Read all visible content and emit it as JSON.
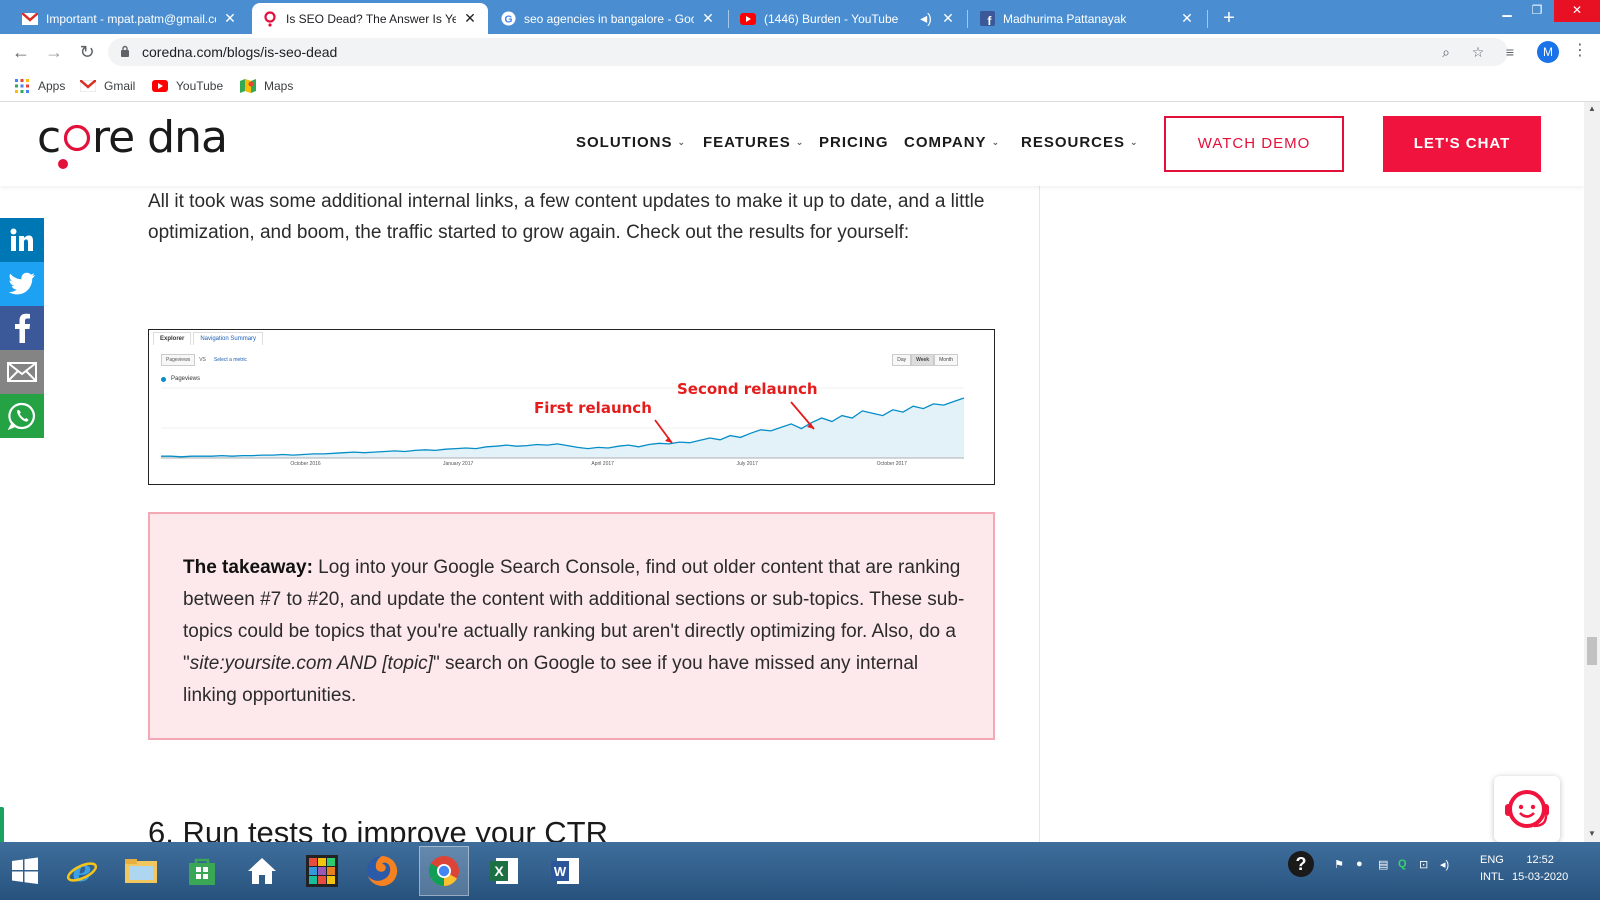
{
  "browser": {
    "tabs": [
      {
        "title": "Important - mpat.patm@gmail.co",
        "icon": "gmail-icon",
        "active": false
      },
      {
        "title": "Is SEO Dead? The Answer Is Yes,",
        "icon": "coredna-icon",
        "active": true
      },
      {
        "title": "seo agencies in bangalore - Goo",
        "icon": "google-icon",
        "active": false
      },
      {
        "title": "(1446) Burden - YouTube",
        "icon": "youtube-icon",
        "active": false
      },
      {
        "title": "Madhurima Pattanayak",
        "icon": "facebook-icon",
        "active": false
      }
    ],
    "close_glyph": "✕",
    "new_tab_glyph": "+",
    "url": "coredna.com/blogs/is-seo-dead",
    "avatar_letter": "M",
    "bookmarks": [
      {
        "label": "Apps",
        "icon": "apps-grid-icon"
      },
      {
        "label": "Gmail",
        "icon": "gmail-icon"
      },
      {
        "label": "YouTube",
        "icon": "youtube-icon"
      },
      {
        "label": "Maps",
        "icon": "maps-icon"
      }
    ]
  },
  "site": {
    "logo_text": "core dna",
    "nav": [
      {
        "label": "SOLUTIONS",
        "has_dropdown": true
      },
      {
        "label": "FEATURES",
        "has_dropdown": true
      },
      {
        "label": "PRICING",
        "has_dropdown": false
      },
      {
        "label": "COMPANY",
        "has_dropdown": true
      },
      {
        "label": "RESOURCES",
        "has_dropdown": true
      }
    ],
    "watch_demo": "WATCH DEMO",
    "lets_chat": "LET'S CHAT",
    "brand_color": "#f0133d"
  },
  "article": {
    "intro": "All it took was some additional internal links, a few content updates to make it up to date, and a little optimization, and boom, the traffic started to grow again. Check out the results for yourself:",
    "takeaway_label": "The takeaway:",
    "takeaway_text_1": " Log into your Google Search Console, find out older content that are ranking between #7 to #20, and update the content with additional sections or sub-topics. These sub-topics could be topics that you're actually ranking but aren't directly optimizing for. Also, do a \"",
    "takeaway_italic": "site:yoursite.com AND [topic]",
    "takeaway_text_2": "\" search on Google to see if you have missed any internal linking opportunities.",
    "next_heading": "6. Run tests to improve your CTR"
  },
  "share": [
    {
      "icon": "linkedin-icon",
      "label": "in",
      "color": "#0077b5"
    },
    {
      "icon": "twitter-icon",
      "label": "t",
      "color": "#1da1f2"
    },
    {
      "icon": "facebook-icon",
      "label": "f",
      "color": "#3b5998"
    },
    {
      "icon": "email-icon",
      "label": "✉",
      "color": "#848484"
    },
    {
      "icon": "whatsapp-icon",
      "label": "✆",
      "color": "#25a244"
    }
  ],
  "analytics": {
    "tabs": [
      "Explorer",
      "Navigation Summary"
    ],
    "metric": "Pageviews",
    "vs": "VS",
    "select_metric": "Select a metric",
    "periods": [
      "Day",
      "Week",
      "Month"
    ],
    "active_period": "Week",
    "legend": "Pageviews",
    "annotation_1": "First relaunch",
    "annotation_2": "Second relaunch"
  },
  "chart_data": {
    "type": "area",
    "series": [
      {
        "name": "Pageviews",
        "values": [
          3,
          3,
          2,
          3,
          3,
          3,
          4,
          3,
          4,
          4,
          5,
          5,
          6,
          5,
          6,
          7,
          7,
          8,
          9,
          10,
          9,
          10,
          11,
          12,
          11,
          13,
          14,
          13,
          15,
          16,
          17,
          16,
          19,
          20,
          22,
          20,
          21,
          23,
          22,
          24,
          21,
          18,
          16,
          18,
          17,
          20,
          22,
          19,
          23,
          25,
          24,
          27,
          26,
          30,
          34,
          31,
          38,
          35,
          42,
          48,
          46,
          52,
          58,
          50,
          60,
          68,
          62,
          72,
          68,
          80,
          76,
          72,
          82,
          78,
          88,
          84,
          92,
          90,
          96,
          102
        ]
      }
    ],
    "x_tick_labels": [
      "October 2016",
      "January 2017",
      "April 2017",
      "July 2017",
      "October 2017"
    ],
    "color": "#058dc7"
  },
  "taskbar": {
    "items": [
      "start-button",
      "internet-explorer-icon",
      "file-explorer-icon",
      "store-icon",
      "home-icon",
      "app-icon",
      "firefox-icon",
      "chrome-icon",
      "excel-icon",
      "word-icon"
    ],
    "lang_1": "ENG",
    "lang_2": "INTL",
    "time": "12:52",
    "date": "15-03-2020"
  }
}
